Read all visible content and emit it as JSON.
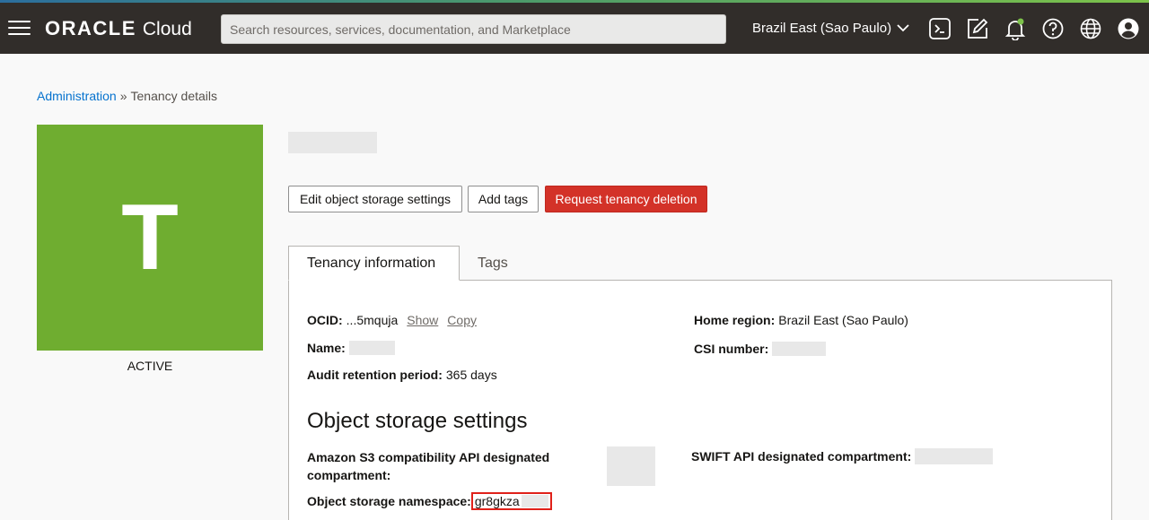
{
  "topbar": {
    "menu_icon": "hamburger-menu-icon",
    "brand": "ORACLE",
    "product": "Cloud",
    "search_placeholder": "Search resources, services, documentation, and Marketplace",
    "region": "Brazil East (Sao Paulo)",
    "icons": [
      "cloud-shell-icon",
      "edit-note-icon",
      "notification-bell-icon",
      "help-icon",
      "language-globe-icon",
      "user-profile-icon"
    ],
    "notification_dot_color": "#7cc24a"
  },
  "breadcrumb": {
    "parent": "Administration",
    "separator": "»",
    "current": "Tenancy details"
  },
  "tenancy": {
    "avatar_letter": "T",
    "avatar_color": "#6fad30",
    "status": "ACTIVE"
  },
  "actions": {
    "edit": "Edit object storage settings",
    "tags": "Add tags",
    "delete": "Request tenancy deletion",
    "delete_color": "#d33228"
  },
  "tabs": {
    "info": "Tenancy information",
    "tags": "Tags"
  },
  "info": {
    "ocid_label": "OCID:",
    "ocid_value": "...5mquja",
    "show": "Show",
    "copy": "Copy",
    "name_label": "Name:",
    "audit_label": "Audit retention period:",
    "audit_value": "365 days",
    "home_region_label": "Home region:",
    "home_region_value": "Brazil East (Sao Paulo)",
    "csi_label": "CSI number:"
  },
  "object_storage": {
    "title": "Object storage settings",
    "s3_label_line1": "Amazon S3 compatibility API designated",
    "s3_label_line2": "compartment:",
    "swift_label": "SWIFT API designated compartment:",
    "namespace_label": "Object storage namespace:",
    "namespace_value": "gr8gkza"
  }
}
